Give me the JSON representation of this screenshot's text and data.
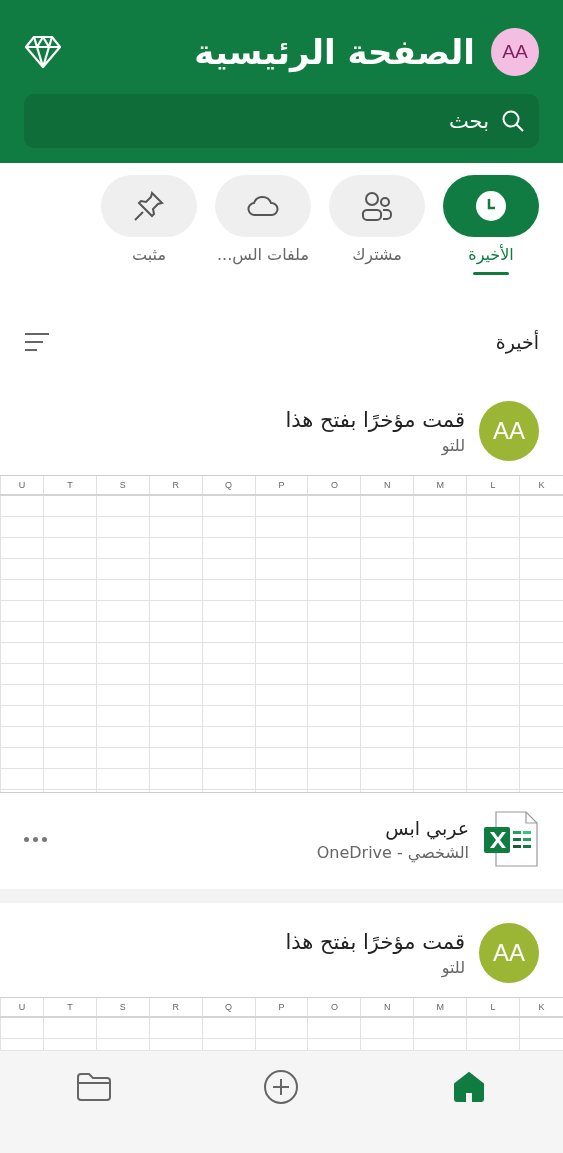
{
  "header": {
    "title": "الصفحة الرئيسية",
    "avatar": "AA",
    "search": {
      "placeholder": "بحث"
    }
  },
  "tabs": [
    {
      "label": "الأخيرة",
      "kind": "recent",
      "selected": true
    },
    {
      "label": "مشترك",
      "kind": "shared",
      "selected": false
    },
    {
      "label": "ملفات الس...",
      "kind": "cloud",
      "selected": false
    },
    {
      "label": "مثبت",
      "kind": "pinned",
      "selected": false
    }
  ],
  "section": {
    "title": "أخيرة"
  },
  "cards": [
    {
      "avatar": "AA",
      "activity": "قمت مؤخرًا بفتح هذا",
      "time": "للتو",
      "columns": [
        "K",
        "L",
        "M",
        "N",
        "O",
        "P",
        "Q",
        "R",
        "S",
        "T",
        "U"
      ],
      "file": {
        "name": "عربي ابس",
        "location": "الشخصي - OneDrive"
      }
    },
    {
      "avatar": "AA",
      "activity": "قمت مؤخرًا بفتح هذا",
      "time": "للتو",
      "columns": [
        "K",
        "L",
        "M",
        "N",
        "O",
        "P",
        "Q",
        "R",
        "S",
        "T",
        "U"
      ]
    }
  ],
  "bottom_nav": [
    {
      "kind": "folder",
      "selected": false
    },
    {
      "kind": "add",
      "selected": false
    },
    {
      "kind": "home",
      "selected": true
    }
  ]
}
